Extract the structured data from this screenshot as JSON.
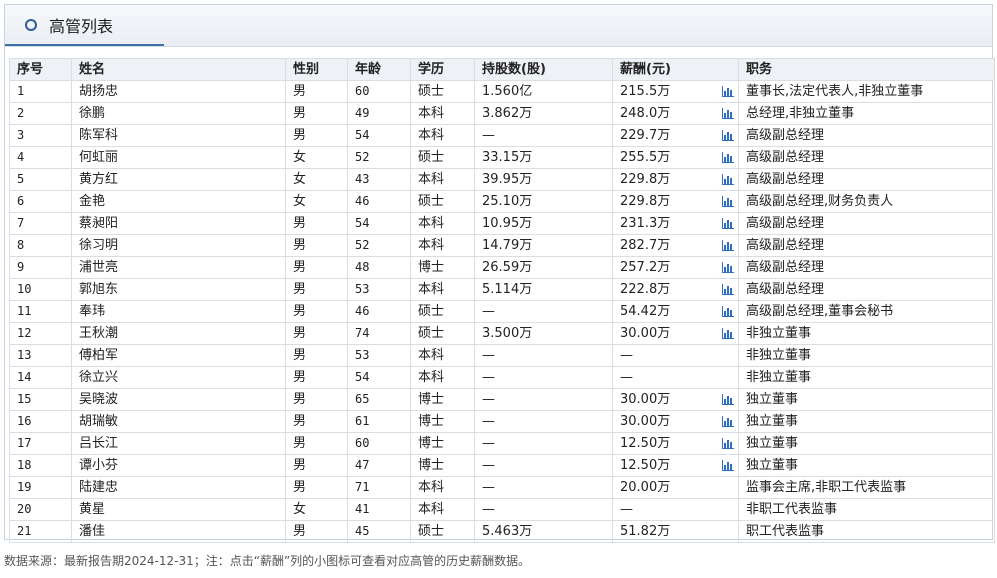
{
  "panel": {
    "title": "高管列表"
  },
  "table": {
    "headers": [
      "序号",
      "姓名",
      "性别",
      "年龄",
      "学历",
      "持股数(股)",
      "薪酬(元)",
      "职务"
    ],
    "rows": [
      {
        "no": "1",
        "name": "胡扬忠",
        "gender": "男",
        "age": "60",
        "edu": "硕士",
        "shares": "1.560亿",
        "pay": "215.5万",
        "icon": true,
        "title": "董事长,法定代表人,非独立董事"
      },
      {
        "no": "2",
        "name": "徐鹏",
        "gender": "男",
        "age": "49",
        "edu": "本科",
        "shares": "3.862万",
        "pay": "248.0万",
        "icon": true,
        "title": "总经理,非独立董事"
      },
      {
        "no": "3",
        "name": "陈军科",
        "gender": "男",
        "age": "54",
        "edu": "本科",
        "shares": "—",
        "pay": "229.7万",
        "icon": true,
        "title": "高级副总经理"
      },
      {
        "no": "4",
        "name": "何虹丽",
        "gender": "女",
        "age": "52",
        "edu": "硕士",
        "shares": "33.15万",
        "pay": "255.5万",
        "icon": true,
        "title": "高级副总经理"
      },
      {
        "no": "5",
        "name": "黄方红",
        "gender": "女",
        "age": "43",
        "edu": "本科",
        "shares": "39.95万",
        "pay": "229.8万",
        "icon": true,
        "title": "高级副总经理"
      },
      {
        "no": "6",
        "name": "金艳",
        "gender": "女",
        "age": "46",
        "edu": "硕士",
        "shares": "25.10万",
        "pay": "229.8万",
        "icon": true,
        "title": "高级副总经理,财务负责人"
      },
      {
        "no": "7",
        "name": "蔡昶阳",
        "gender": "男",
        "age": "54",
        "edu": "本科",
        "shares": "10.95万",
        "pay": "231.3万",
        "icon": true,
        "title": "高级副总经理"
      },
      {
        "no": "8",
        "name": "徐习明",
        "gender": "男",
        "age": "52",
        "edu": "本科",
        "shares": "14.79万",
        "pay": "282.7万",
        "icon": true,
        "title": "高级副总经理"
      },
      {
        "no": "9",
        "name": "浦世亮",
        "gender": "男",
        "age": "48",
        "edu": "博士",
        "shares": "26.59万",
        "pay": "257.2万",
        "icon": true,
        "title": "高级副总经理"
      },
      {
        "no": "10",
        "name": "郭旭东",
        "gender": "男",
        "age": "53",
        "edu": "本科",
        "shares": "5.114万",
        "pay": "222.8万",
        "icon": true,
        "title": "高级副总经理"
      },
      {
        "no": "11",
        "name": "奉玮",
        "gender": "男",
        "age": "46",
        "edu": "硕士",
        "shares": "—",
        "pay": "54.42万",
        "icon": true,
        "title": "高级副总经理,董事会秘书"
      },
      {
        "no": "12",
        "name": "王秋潮",
        "gender": "男",
        "age": "74",
        "edu": "硕士",
        "shares": "3.500万",
        "pay": "30.00万",
        "icon": true,
        "title": "非独立董事"
      },
      {
        "no": "13",
        "name": "傅柏军",
        "gender": "男",
        "age": "53",
        "edu": "本科",
        "shares": "—",
        "pay": "—",
        "icon": false,
        "title": "非独立董事"
      },
      {
        "no": "14",
        "name": "徐立兴",
        "gender": "男",
        "age": "54",
        "edu": "本科",
        "shares": "—",
        "pay": "—",
        "icon": false,
        "title": "非独立董事"
      },
      {
        "no": "15",
        "name": "吴晓波",
        "gender": "男",
        "age": "65",
        "edu": "博士",
        "shares": "—",
        "pay": "30.00万",
        "icon": true,
        "title": "独立董事"
      },
      {
        "no": "16",
        "name": "胡瑞敏",
        "gender": "男",
        "age": "61",
        "edu": "博士",
        "shares": "—",
        "pay": "30.00万",
        "icon": true,
        "title": "独立董事"
      },
      {
        "no": "17",
        "name": "吕长江",
        "gender": "男",
        "age": "60",
        "edu": "博士",
        "shares": "—",
        "pay": "12.50万",
        "icon": true,
        "title": "独立董事"
      },
      {
        "no": "18",
        "name": "谭小芬",
        "gender": "男",
        "age": "47",
        "edu": "博士",
        "shares": "—",
        "pay": "12.50万",
        "icon": true,
        "title": "独立董事"
      },
      {
        "no": "19",
        "name": "陆建忠",
        "gender": "男",
        "age": "71",
        "edu": "本科",
        "shares": "—",
        "pay": "20.00万",
        "icon": false,
        "title": "监事会主席,非职工代表监事"
      },
      {
        "no": "20",
        "name": "黄星",
        "gender": "女",
        "age": "41",
        "edu": "本科",
        "shares": "—",
        "pay": "—",
        "icon": false,
        "title": "非职工代表监事"
      },
      {
        "no": "21",
        "name": "潘佳",
        "gender": "男",
        "age": "45",
        "edu": "硕士",
        "shares": "5.463万",
        "pay": "51.82万",
        "icon": false,
        "title": "职工代表监事"
      }
    ]
  },
  "footer": {
    "note": "数据来源：最新报告期2024-12-31；注：点击“薪酬”列的小图标可查看对应高管的历史薪酬数据。"
  },
  "colors": {
    "accent": "#3f6fa6",
    "icon": "#2f6fbf"
  }
}
